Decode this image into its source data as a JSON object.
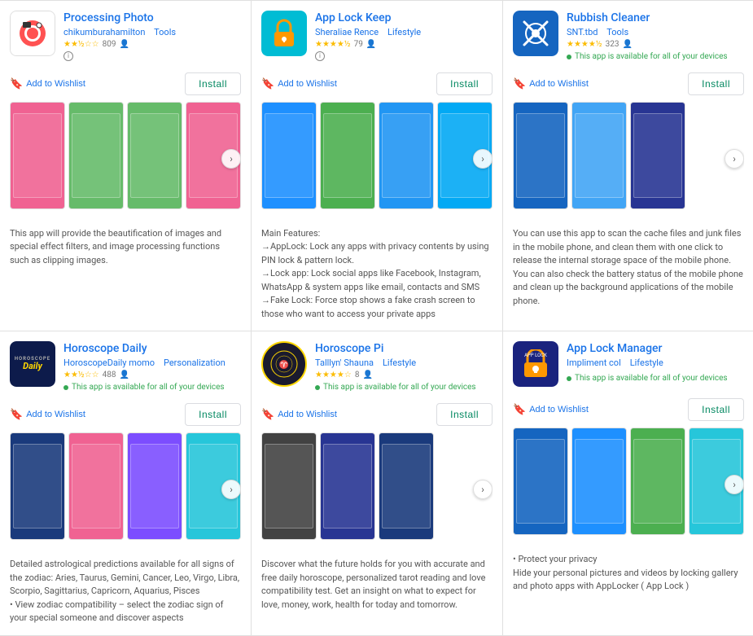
{
  "apps": [
    {
      "id": "processing-photo",
      "name": "Processing Photo",
      "author": "chikumburahamilton",
      "category": "Tools",
      "rating": 2.5,
      "rating_count": "809",
      "has_availability": false,
      "install_label": "Install",
      "wishlist_label": "Add to Wishlist",
      "description": "This app will provide the beautification of images and special effect filters, and image processing functions such as clipping images.",
      "icon_type": "processing",
      "screenshots": [
        "ss-pink",
        "ss-green",
        "ss-green",
        "ss-pink"
      ]
    },
    {
      "id": "app-lock-keep",
      "name": "App Lock Keep",
      "author": "Sheraliae Rence",
      "category": "Lifestyle",
      "rating": 4.5,
      "rating_count": "79",
      "has_availability": false,
      "install_label": "Install",
      "wishlist_label": "Add to Wishlist",
      "description": "Main Features:\n→AppLock: Lock any apps with privacy contents by using PIN lock & pattern lock.\n→Lock app: Lock social apps like Facebook, Instagram, WhatsApp & system apps like email, contacts and SMS\n→Fake Lock: Force stop shows a fake crash screen to those who want to access your private apps",
      "icon_type": "applock",
      "screenshots": [
        "ss-gesturelock",
        "ss-passwordlock",
        "ss-fingerprint",
        "ss-applock2"
      ]
    },
    {
      "id": "rubbish-cleaner",
      "name": "Rubbish Cleaner",
      "author": "SNT.tbd",
      "category": "Tools",
      "rating": 4.5,
      "rating_count": "323",
      "has_availability": true,
      "availability_text": "This app is available for all of your devices",
      "install_label": "Install",
      "wishlist_label": "Add to Wishlist",
      "description": "You can use this app to scan the cache files and junk files in the mobile phone, and clean them with one click to release the internal storage space of the mobile phone. You can also check the battery status of the mobile phone and clean up the background applications of the mobile phone.",
      "icon_type": "rubbish",
      "screenshots": [
        "ss-deepblue",
        "ss-blue",
        "ss-darkblue"
      ]
    },
    {
      "id": "horoscope-daily",
      "name": "Horoscope Daily",
      "author": "HoroscopeDaily momo",
      "category": "Personalization",
      "rating": 2.5,
      "rating_count": "488",
      "has_availability": true,
      "availability_text": "This app is available for all of your devices",
      "install_label": "Install",
      "wishlist_label": "Add to Wishlist",
      "description": "Detailed astrological predictions available for all signs of the zodiac: Aries, Taurus, Gemini, Cancer, Leo, Virgo, Libra, Scorpio, Sagittarius, Capricorn, Aquarius, Pisces",
      "description_more": "• View zodiac compatibility – select the zodiac sign of your special someone and discover aspects",
      "icon_type": "horoscope",
      "screenshots": [
        "ss-navy",
        "ss-pink",
        "ss-purple",
        "ss-teal"
      ]
    },
    {
      "id": "horoscope-pi",
      "name": "Horoscope Pi",
      "author": "Talllyn' Shauna",
      "category": "Lifestyle",
      "rating": 4.0,
      "rating_count": "8",
      "has_availability": true,
      "availability_text": "This app is available for all of your devices",
      "install_label": "Install",
      "wishlist_label": "Add to Wishlist",
      "description": "Discover what the future holds for you with accurate and free daily horoscope, personalized tarot reading and love compatibility test. Get an insight on what to expect for love, money, work, health for today and tomorrow.",
      "icon_type": "horoscopepi",
      "screenshots": [
        "ss-dark",
        "ss-darkblue",
        "ss-navy"
      ]
    },
    {
      "id": "app-lock-manager",
      "name": "App Lock Manager",
      "author": "Impliment col",
      "category": "Lifestyle",
      "rating": 0,
      "rating_count": "",
      "has_availability": true,
      "availability_text": "This app is available for all of your devices",
      "install_label": "Install",
      "wishlist_label": "Add to Wishlist",
      "description": "• Protect your privacy\nHide your personal pictures and videos by locking gallery and photo apps with AppLocker ( App Lock )",
      "icon_type": "applockmanager",
      "screenshots": [
        "ss-deepblue",
        "ss-gesturelock",
        "ss-passwordlock",
        "ss-teal"
      ]
    }
  ]
}
